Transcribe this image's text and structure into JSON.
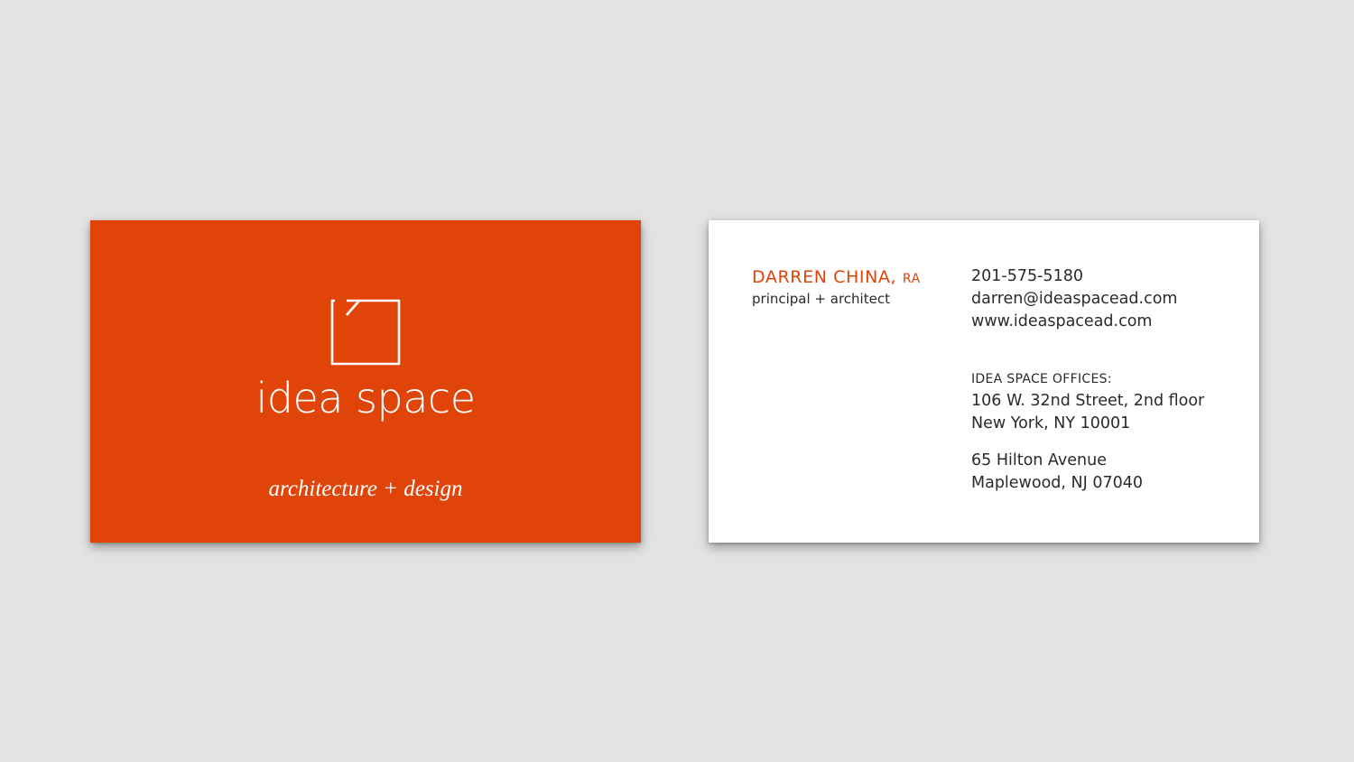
{
  "scene": {
    "background_color": "#e3e3e3"
  },
  "card_front": {
    "background_color": "#e04409",
    "logo_icon": "open-square-mark-icon",
    "brand_name": "idea space",
    "tagline": "architecture + design"
  },
  "card_back": {
    "background_color": "#ffffff",
    "accent_color": "#e04409",
    "name": "DARREN CHINA,",
    "credential": "RA",
    "role": "principal + architect",
    "phone": "201-575-5180",
    "email": "darren@ideaspacead.com",
    "website": "www.ideaspacead.com",
    "offices_heading": "IDEA SPACE OFFICES:",
    "offices": [
      {
        "line1": "106 W. 32nd Street, 2nd floor",
        "line2": "New York, NY 10001"
      },
      {
        "line1": "65 Hilton Avenue",
        "line2": "Maplewood, NJ 07040"
      }
    ]
  }
}
